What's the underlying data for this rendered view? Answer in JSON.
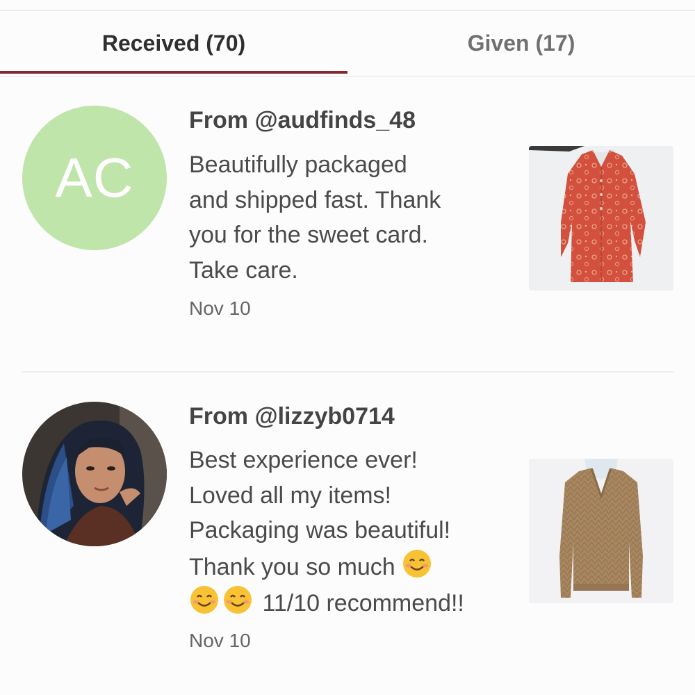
{
  "tabs": {
    "received_label": "Received (70)",
    "given_label": "Given (17)",
    "active": "received"
  },
  "reviews": [
    {
      "from": "From @audfinds_48",
      "avatar_initials": "AC",
      "avatar_color": "#bfe5aa",
      "comment_lines": [
        "Beautifully packaged",
        "and shipped fast. Thank",
        "you for the sweet card.",
        "Take care."
      ],
      "date": "Nov 10",
      "item_icon": "orange-floral-blouse"
    },
    {
      "from": "From @lizzyb0714",
      "avatar_icon": "user-photo",
      "comment_lines": [
        "Best experience ever!",
        "Loved all my items!",
        "Packaging was beautiful!",
        "Thank you so much",
        "11/10 recommend!!"
      ],
      "emoji_icon": "smiling-face-emoji",
      "date": "Nov 10",
      "item_icon": "tan-v-neck-sweater"
    }
  ],
  "colors": {
    "accent": "#822b30",
    "tab_active_text": "#2f2f2f",
    "tab_inactive_text": "#707070"
  }
}
